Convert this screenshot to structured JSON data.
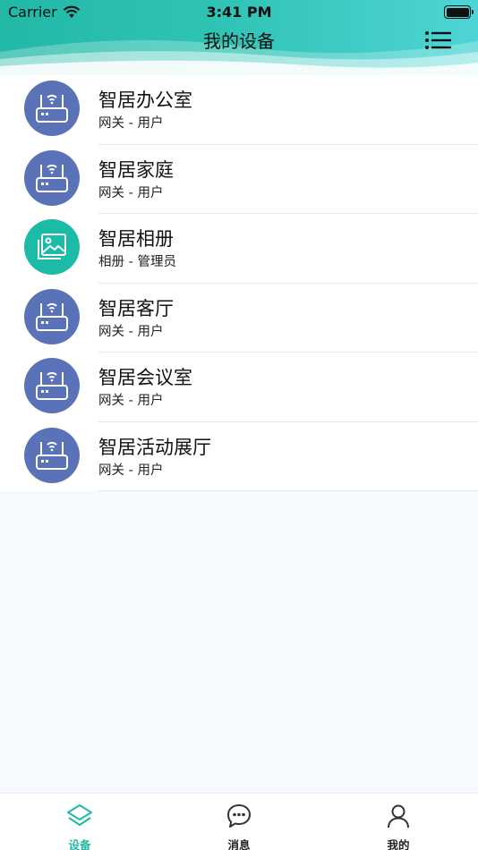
{
  "status_bar": {
    "carrier": "Carrier",
    "time": "3:41 PM"
  },
  "header": {
    "title": "我的设备"
  },
  "colors": {
    "accent": "#22b8a6",
    "router_bg": "#5a72b8",
    "album_bg": "#1bbba7"
  },
  "devices": [
    {
      "name": "智居办公室",
      "subtitle": "网关 - 用户",
      "icon": "router-icon"
    },
    {
      "name": "智居家庭",
      "subtitle": "网关 - 用户",
      "icon": "router-icon"
    },
    {
      "name": "智居相册",
      "subtitle": "相册 - 管理员",
      "icon": "photo-album-icon"
    },
    {
      "name": "智居客厅",
      "subtitle": "网关 - 用户",
      "icon": "router-icon"
    },
    {
      "name": "智居会议室",
      "subtitle": "网关 - 用户",
      "icon": "router-icon"
    },
    {
      "name": "智居活动展厅",
      "subtitle": "网关 - 用户",
      "icon": "router-icon"
    }
  ],
  "tabs": [
    {
      "label": "设备",
      "icon": "layers-icon",
      "active": true
    },
    {
      "label": "消息",
      "icon": "chat-bubble-icon",
      "active": false
    },
    {
      "label": "我的",
      "icon": "person-icon",
      "active": false
    }
  ]
}
